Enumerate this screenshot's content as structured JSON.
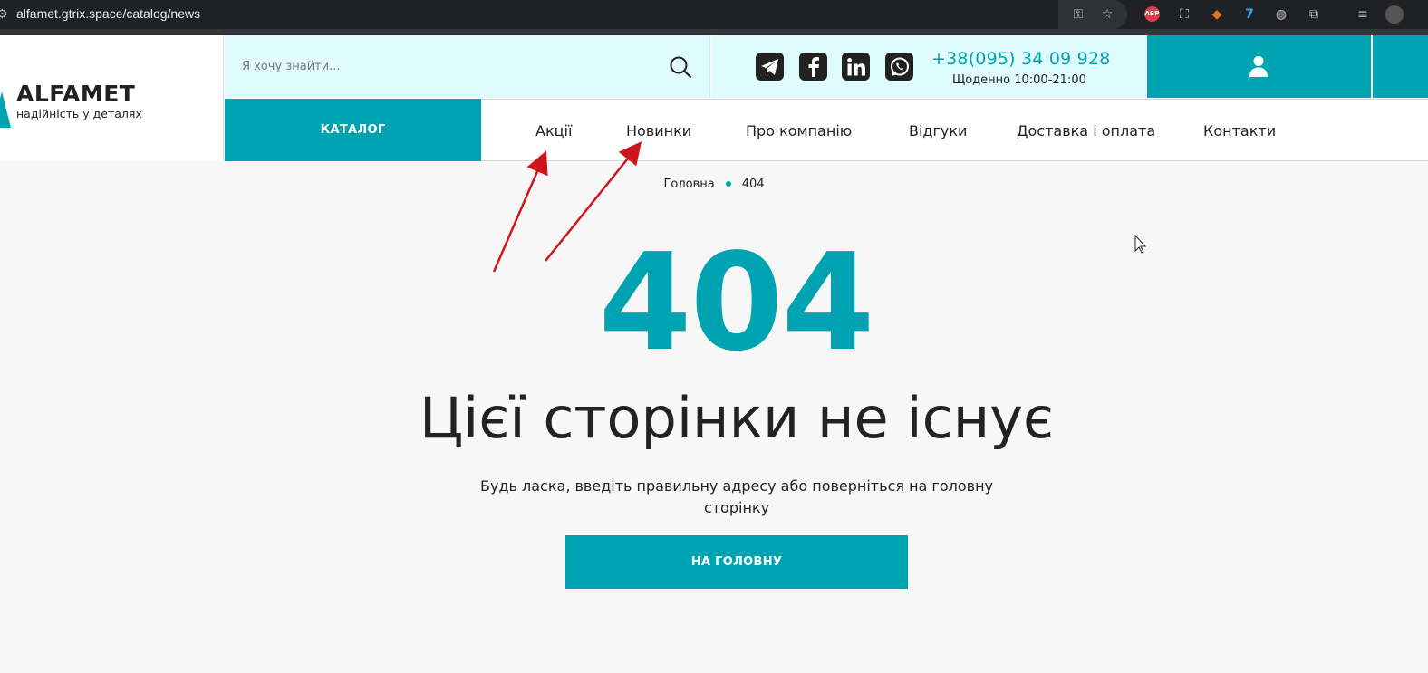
{
  "browser": {
    "url": "alfamet.gtrix.space/catalog/news"
  },
  "logo": {
    "name": "ALFAMET",
    "tagline": "надійність у деталях"
  },
  "search": {
    "placeholder": "Я хочу знайти..."
  },
  "contacts": {
    "phone": "+38(095) 34 09 928",
    "hours": "Щоденно 10:00-21:00"
  },
  "nav": {
    "catalog_label": "КАТАЛОГ",
    "items": [
      {
        "label": "Акції"
      },
      {
        "label": "Новинки"
      },
      {
        "label": "Про компанію"
      },
      {
        "label": "Відгуки"
      },
      {
        "label": "Доставка і оплата"
      },
      {
        "label": "Контакти"
      }
    ]
  },
  "breadcrumb": {
    "home": "Головна",
    "current": "404"
  },
  "error": {
    "code": "404",
    "title": "Цієї сторінки не існує",
    "message": "Будь ласка, введіть правильну адресу або поверніться на головну сторінку",
    "button_label": "НА ГОЛОВНУ"
  },
  "colors": {
    "accent": "#00a3b1",
    "search_bg": "#e0fbfd",
    "annotation": "#d0141c"
  }
}
